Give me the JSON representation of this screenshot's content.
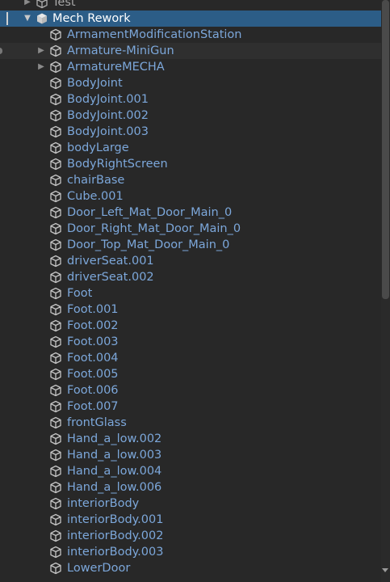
{
  "hierarchy": {
    "partial_top": {
      "label": "Test",
      "icon": "prefab-cube-icon"
    },
    "root": {
      "label": "Mech Rework",
      "icon": "prefab-cube-filled-icon",
      "expanded": true
    },
    "children": [
      {
        "label": "ArmamentModificationStation",
        "expandable": false
      },
      {
        "label": "Armature-MiniGun",
        "expandable": true
      },
      {
        "label": "ArmatureMECHA",
        "expandable": true
      },
      {
        "label": "BodyJoint",
        "expandable": false
      },
      {
        "label": "BodyJoint.001",
        "expandable": false
      },
      {
        "label": "BodyJoint.002",
        "expandable": false
      },
      {
        "label": "BodyJoint.003",
        "expandable": false
      },
      {
        "label": "bodyLarge",
        "expandable": false
      },
      {
        "label": "BodyRightScreen",
        "expandable": false
      },
      {
        "label": "chairBase",
        "expandable": false
      },
      {
        "label": "Cube.001",
        "expandable": false
      },
      {
        "label": "Door_Left_Mat_Door_Main_0",
        "expandable": false
      },
      {
        "label": "Door_Right_Mat_Door_Main_0",
        "expandable": false
      },
      {
        "label": "Door_Top_Mat_Door_Main_0",
        "expandable": false
      },
      {
        "label": "driverSeat.001",
        "expandable": false
      },
      {
        "label": "driverSeat.002",
        "expandable": false
      },
      {
        "label": "Foot",
        "expandable": false
      },
      {
        "label": "Foot.001",
        "expandable": false
      },
      {
        "label": "Foot.002",
        "expandable": false
      },
      {
        "label": "Foot.003",
        "expandable": false
      },
      {
        "label": "Foot.004",
        "expandable": false
      },
      {
        "label": "Foot.005",
        "expandable": false
      },
      {
        "label": "Foot.006",
        "expandable": false
      },
      {
        "label": "Foot.007",
        "expandable": false
      },
      {
        "label": "frontGlass",
        "expandable": false
      },
      {
        "label": "Hand_a_low.002",
        "expandable": false
      },
      {
        "label": "Hand_a_low.003",
        "expandable": false
      },
      {
        "label": "Hand_a_low.004",
        "expandable": false
      },
      {
        "label": "Hand_a_low.006",
        "expandable": false
      },
      {
        "label": "interiorBody",
        "expandable": false
      },
      {
        "label": "interiorBody.001",
        "expandable": false
      },
      {
        "label": "interiorBody.002",
        "expandable": false
      },
      {
        "label": "interiorBody.003",
        "expandable": false
      },
      {
        "label": "LowerDoor",
        "expandable": false
      }
    ]
  },
  "colors": {
    "background": "#282828",
    "selected_row": "#2C5D87",
    "prefab_text": "#7CA7DA",
    "icon_stroke": "#c4c4c4"
  }
}
